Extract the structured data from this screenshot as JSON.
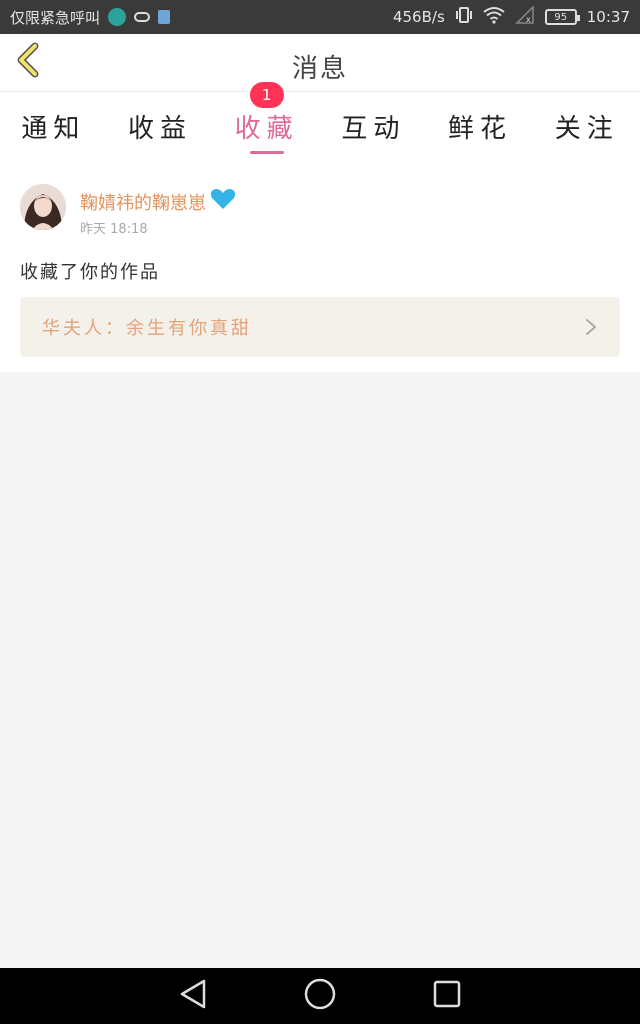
{
  "status_bar": {
    "carrier_text": "仅限紧急呼叫",
    "network_speed": "456B/s",
    "battery_level": "95",
    "time": "10:37",
    "icons": [
      "app-icon",
      "bluetooth-glasses-icon",
      "download-icon",
      "vibrate-icon",
      "wifi-icon",
      "signal-icon",
      "battery-icon"
    ]
  },
  "header": {
    "title": "消息",
    "back_icon": "chevron-left-icon",
    "accent_color": "#f3e36a"
  },
  "tabs": [
    {
      "label": "通知",
      "active": false
    },
    {
      "label": "收益",
      "active": false
    },
    {
      "label": "收藏",
      "active": true,
      "badge": "1"
    },
    {
      "label": "互动",
      "active": false
    },
    {
      "label": "鲜花",
      "active": false
    },
    {
      "label": "关注",
      "active": false
    }
  ],
  "message": {
    "sender_name": "鞠婧祎的鞠崽崽",
    "sender_icon": "heart-icon",
    "time": "昨天 18:18",
    "action_text": "收藏了你的作品",
    "work_title": "华夫人：余生有你真甜",
    "chevron_icon": "chevron-right-icon"
  },
  "colors": {
    "active_tab": "#e06b9a",
    "badge": "#ff3355",
    "sender": "#e4935c",
    "work_title": "#e4a27a",
    "heart": "#33b3e6"
  },
  "nav_bar": {
    "icons": [
      "back-triangle-icon",
      "home-circle-icon",
      "recents-square-icon"
    ]
  }
}
